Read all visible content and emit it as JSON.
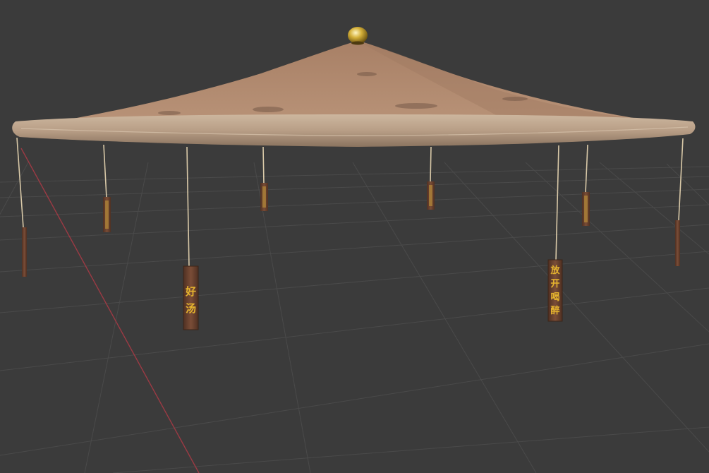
{
  "viewport": {
    "background": "#3b3b3b",
    "grid_color": "#4c4c4c",
    "x_axis_color": "#9c3a44"
  },
  "model": {
    "hat_color": "#b48a6c",
    "hat_shadow": "#8f6b52",
    "brim_color": "#c2ab95",
    "finial_color": "#d4b03a",
    "tag_color": "#6b4330",
    "tag_text_color": "#e6b42e",
    "cord_color": "#d9c9a8"
  },
  "tags": [
    {
      "id": "far-left",
      "text": ""
    },
    {
      "id": "left-mid",
      "text": ""
    },
    {
      "id": "front-left",
      "chars": [
        "好",
        "汤"
      ]
    },
    {
      "id": "back-left",
      "text": ""
    },
    {
      "id": "back-right",
      "text": ""
    },
    {
      "id": "front-right",
      "chars": [
        "放",
        "开",
        "喝",
        "醉"
      ]
    },
    {
      "id": "right-mid",
      "text": ""
    },
    {
      "id": "far-right",
      "text": ""
    }
  ]
}
